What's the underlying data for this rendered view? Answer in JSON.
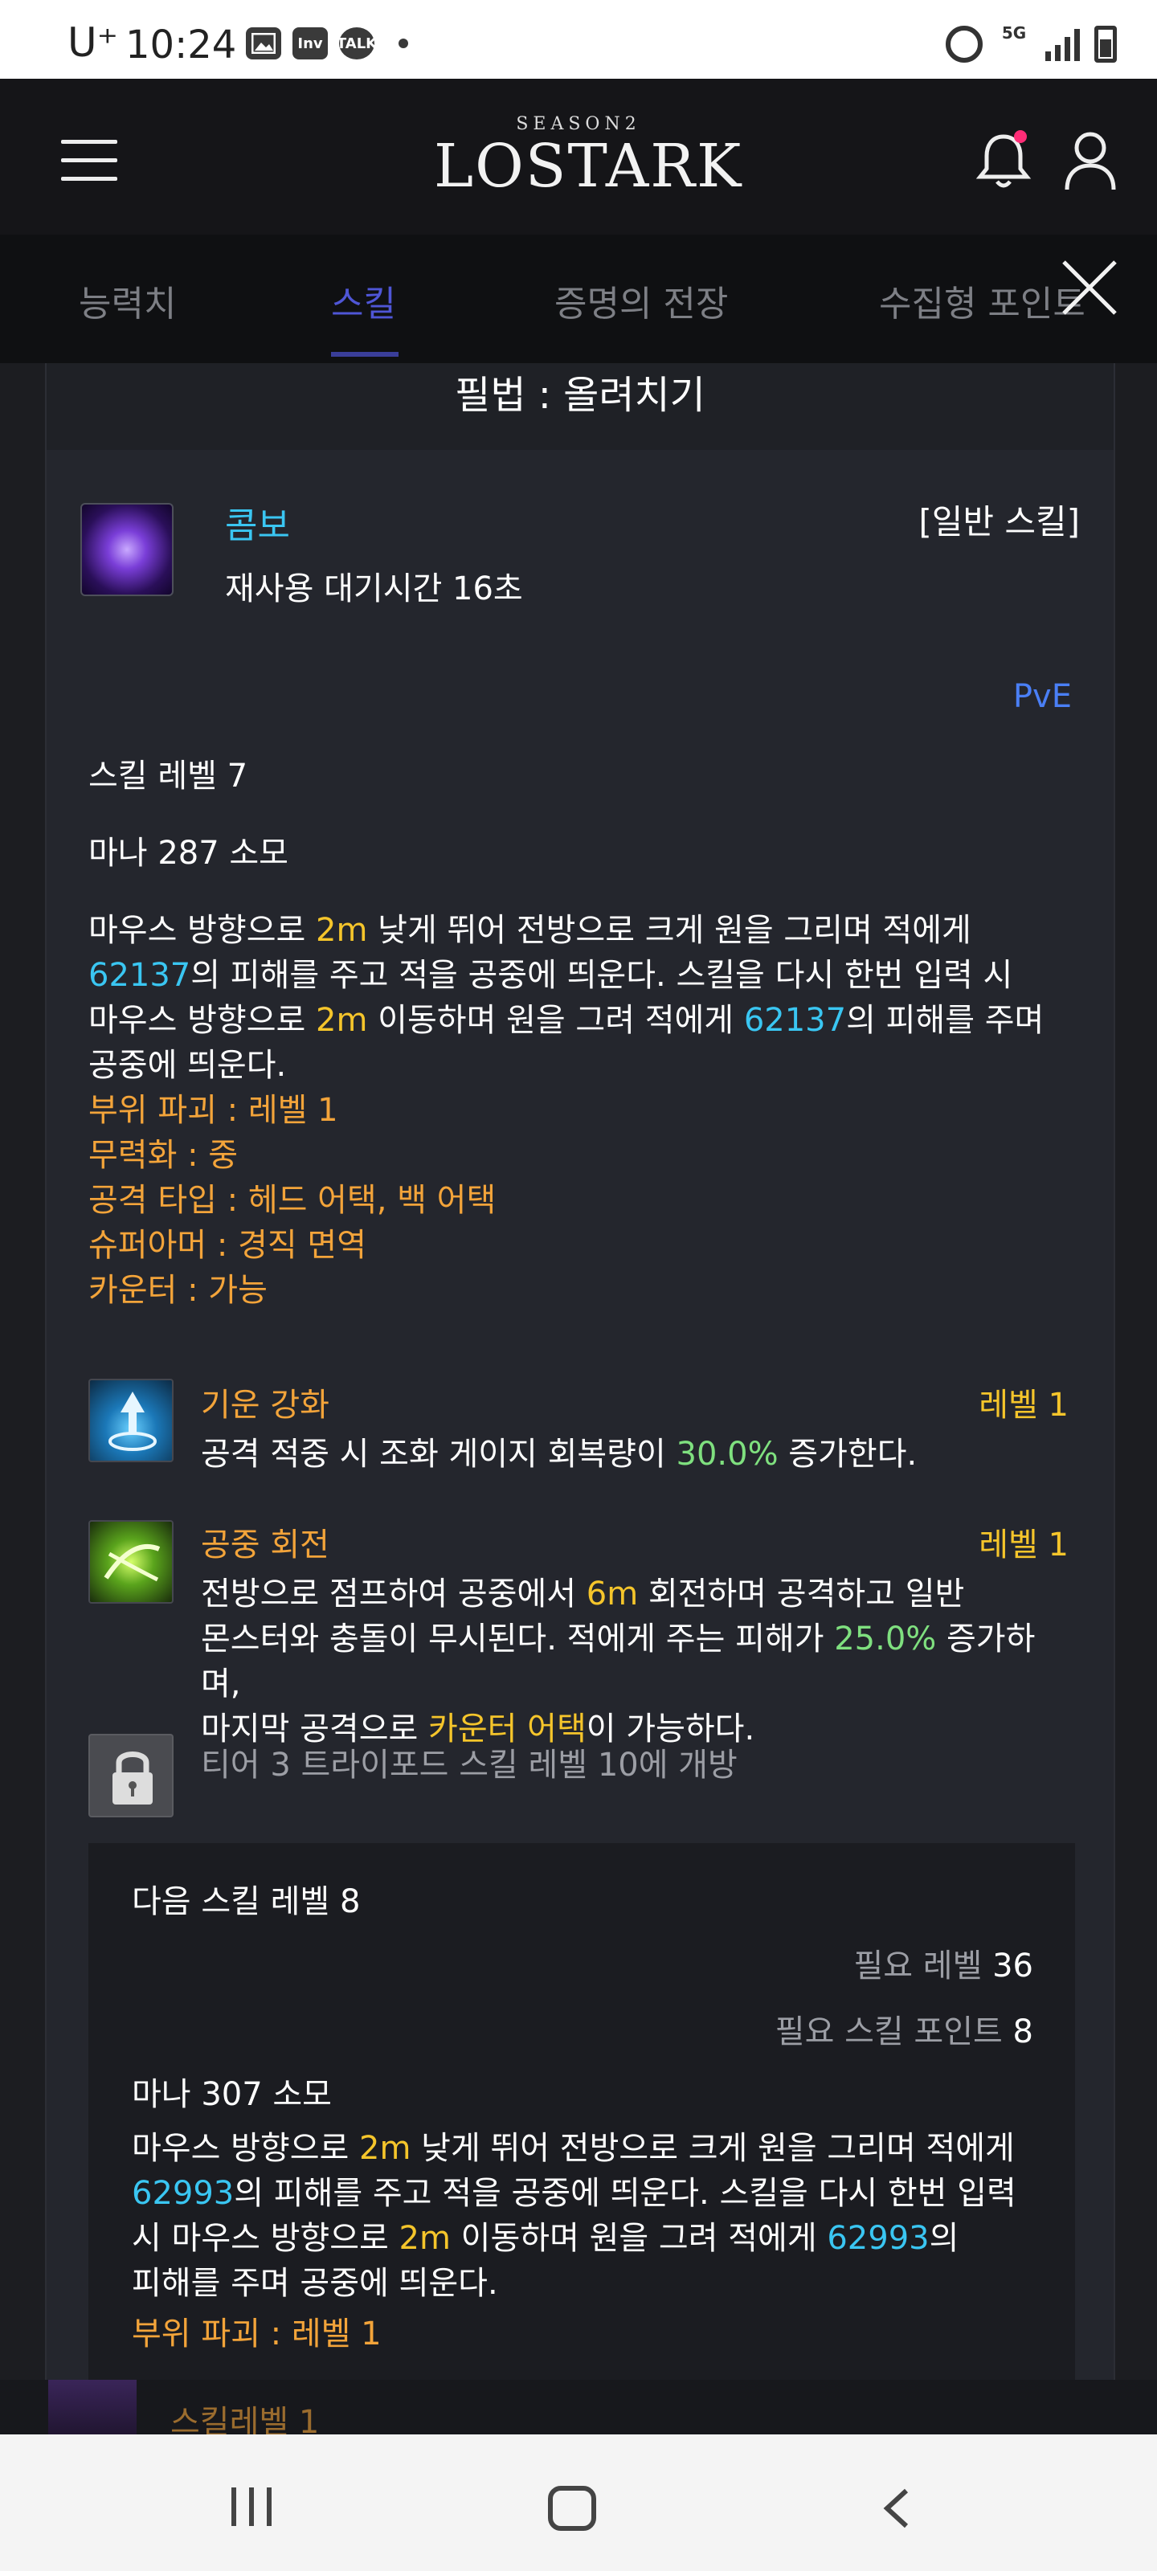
{
  "status_bar": {
    "carrier": "U⁺",
    "time": "10:24",
    "icons_left": [
      "image-icon",
      "inven-icon",
      "talk-icon"
    ],
    "inven_label": "Inv",
    "talk_label": "TALK",
    "network": "5G"
  },
  "header": {
    "logo_season": "SEASON2",
    "logo_name": "LOSTARK"
  },
  "tabs": [
    {
      "label": "능력치"
    },
    {
      "label": "스킬"
    },
    {
      "label": "증명의 전장"
    },
    {
      "label": "수집형 포인트"
    }
  ],
  "modal": {
    "title": "필법 : 올려치기",
    "skill_type": "콤보",
    "skill_kind": "[일반 스킬]",
    "cooldown": "재사용 대기시간 16초",
    "mode": "PvE",
    "skill_level": "스킬 레벨 7",
    "mana": "마나 287 소모",
    "desc": {
      "p1": "마우스 방향으로 ",
      "d1": "2m",
      "p2": " 낮게 뛰어 전방으로 크게 원을 그리며 적에게",
      "dmg1": "62137",
      "p3": "의 피해를 주고 적을 공중에 띄운다. 스킬을 다시 한번 입력 시",
      "p4": "마우스 방향으로 ",
      "d2": "2m",
      "p5": " 이동하며 원을 그려 적에게 ",
      "dmg2": "62137",
      "p6": "의 피해를 주며",
      "p7": "공중에 띄운다."
    },
    "attributes": [
      "부위 파괴 : 레벨 1",
      "무력화 : 중",
      "공격 타입 : 헤드 어택, 백 어택",
      "슈퍼아머 : 경직 면역",
      "카운터 : 가능"
    ],
    "tripods": [
      {
        "name": "기운 강화",
        "level": "레벨 1",
        "desc_a": "공격 적중 시 조화 게이지 회복량이 ",
        "value": "30.0%",
        "desc_b": " 증가한다."
      },
      {
        "name": "공중 회전",
        "level": "레벨 1",
        "line1_a": "전방으로 점프하여 공중에서 ",
        "line1_val": "6m",
        "line1_b": " 회전하며 공격하고 일반",
        "line2_a": "몬스터와 충돌이 무시된다. 적에게 주는 피해가 ",
        "line2_val": "25.0%",
        "line2_b": " 증가하며,",
        "line3_a": "마지막 공격으로 ",
        "line3_val": "카운터 어택",
        "line3_b": "이 가능하다."
      }
    ],
    "locked_text": "티어 3 트라이포드 스킬 레벨 10에 개방",
    "next": {
      "title": "다음 스킬 레벨 8",
      "req_level_label": "필요 레벨",
      "req_level": "36",
      "req_points_label": "필요 스킬 포인트",
      "req_points": "8",
      "mana": "마나 307 소모",
      "p1": "마우스 방향으로 ",
      "d1": "2m",
      "p2": " 낮게 뛰어 전방으로 크게 원을 그리며 적에게",
      "dmg1": "62993",
      "p3": "의 피해를 주고 적을 공중에 띄운다. 스킬을 다시 한번 입력",
      "p4": "시 마우스 방향으로 ",
      "d2": "2m",
      "p5": " 이동하며 원을 그려 적에게 ",
      "dmg2": "62993",
      "p6": "의",
      "p7": "피해를 주며 공중에 띄운다.",
      "cut": "부위 파괴 : 레벨 1"
    }
  },
  "peek": {
    "label": "스킬레벨 1"
  },
  "colors": {
    "accent_yellow": "#f5c52b",
    "accent_blue": "#3ac6f2",
    "accent_green": "#7fe07f",
    "accent_orange": "#f3a43a",
    "tab_active": "#4f56d6"
  }
}
